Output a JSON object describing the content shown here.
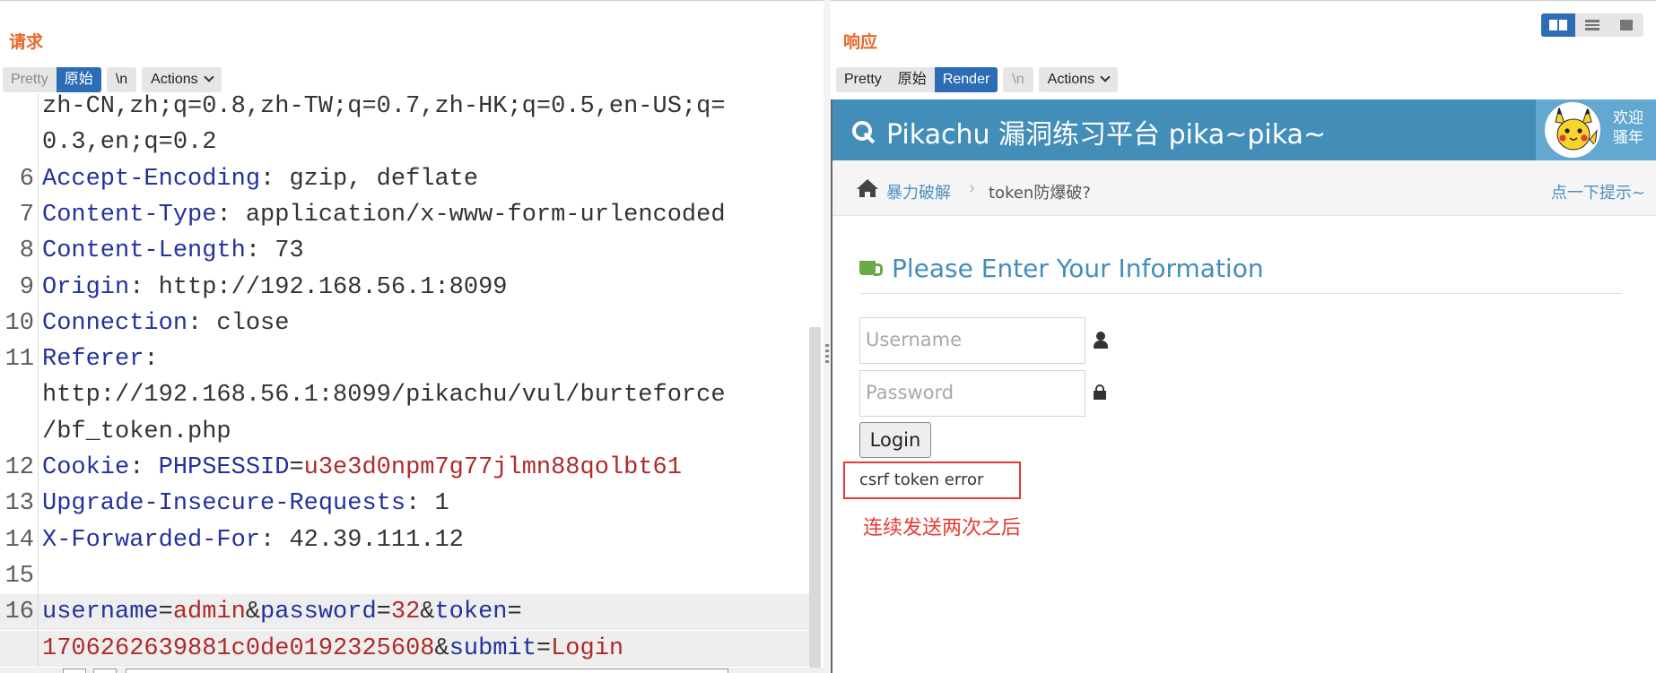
{
  "request": {
    "title": "请求",
    "tabs": {
      "pretty": "Pretty",
      "raw": "原始",
      "newline": "\\n",
      "actions": "Actions"
    },
    "lines": [
      {
        "n": "",
        "segments": [
          {
            "t": "zh-CN,zh;q=0.8,zh-TW;q=0.7,zh-HK;q=0.5,en-US;q=",
            "c": "v"
          }
        ]
      },
      {
        "n": "",
        "segments": [
          {
            "t": "0.3,en;q=0.2",
            "c": "v"
          }
        ]
      },
      {
        "n": "6",
        "segments": [
          {
            "t": "Accept-Encoding",
            "c": "k"
          },
          {
            "t": ": gzip, deflate",
            "c": "v"
          }
        ]
      },
      {
        "n": "7",
        "segments": [
          {
            "t": "Content-Type",
            "c": "k"
          },
          {
            "t": ": application/x-www-form-urlencoded",
            "c": "v"
          }
        ]
      },
      {
        "n": "8",
        "segments": [
          {
            "t": "Content-Length",
            "c": "k"
          },
          {
            "t": ": 73",
            "c": "v"
          }
        ]
      },
      {
        "n": "9",
        "segments": [
          {
            "t": "Origin",
            "c": "k"
          },
          {
            "t": ": http://192.168.56.1:8099",
            "c": "v"
          }
        ]
      },
      {
        "n": "10",
        "segments": [
          {
            "t": "Connection",
            "c": "k"
          },
          {
            "t": ": close",
            "c": "v"
          }
        ]
      },
      {
        "n": "11",
        "segments": [
          {
            "t": "Referer",
            "c": "k"
          },
          {
            "t": ":",
            "c": "v"
          }
        ]
      },
      {
        "n": "",
        "segments": [
          {
            "t": "http://192.168.56.1:8099/pikachu/vul/burteforce",
            "c": "v"
          }
        ]
      },
      {
        "n": "",
        "segments": [
          {
            "t": "/bf_token.php",
            "c": "v"
          }
        ]
      },
      {
        "n": "12",
        "segments": [
          {
            "t": "Cookie",
            "c": "k"
          },
          {
            "t": ": ",
            "c": "v"
          },
          {
            "t": "PHPSESSID",
            "c": "k"
          },
          {
            "t": "=",
            "c": "v"
          },
          {
            "t": "u3e3d0npm7g77jlmn88qolbt61",
            "c": "r"
          }
        ]
      },
      {
        "n": "13",
        "segments": [
          {
            "t": "Upgrade-Insecure-Requests",
            "c": "k"
          },
          {
            "t": ": 1",
            "c": "v"
          }
        ]
      },
      {
        "n": "14",
        "segments": [
          {
            "t": "X-Forwarded-For",
            "c": "k"
          },
          {
            "t": ": 42.39.111.12",
            "c": "v"
          }
        ]
      },
      {
        "n": "15",
        "segments": []
      },
      {
        "n": "16",
        "hl": true,
        "segments": [
          {
            "t": "username",
            "c": "k"
          },
          {
            "t": "=",
            "c": "v"
          },
          {
            "t": "admin",
            "c": "r"
          },
          {
            "t": "&",
            "c": "v"
          },
          {
            "t": "password",
            "c": "k"
          },
          {
            "t": "=",
            "c": "v"
          },
          {
            "t": "32",
            "c": "r"
          },
          {
            "t": "&",
            "c": "v"
          },
          {
            "t": "token",
            "c": "k"
          },
          {
            "t": "=",
            "c": "v"
          }
        ]
      },
      {
        "n": "",
        "hl": true,
        "segments": [
          {
            "t": "1706262639881c0de0192325608",
            "c": "r"
          },
          {
            "t": "&",
            "c": "v"
          },
          {
            "t": "submit",
            "c": "k"
          },
          {
            "t": "=",
            "c": "v"
          },
          {
            "t": "Login",
            "c": "r"
          }
        ]
      }
    ]
  },
  "response": {
    "title": "响应",
    "tabs": {
      "pretty": "Pretty",
      "raw": "原始",
      "render": "Render",
      "newline": "\\n",
      "actions": "Actions"
    },
    "render": {
      "site_title": "Pikachu 漏洞练习平台 pika~pika~",
      "welcome_line1": "欢迎",
      "welcome_line2": "骚年",
      "breadcrumb_1": "暴力破解",
      "breadcrumb_sep": "›",
      "breadcrumb_2": "token防爆破?",
      "hint_link": "点一下提示~",
      "section_title": "Please Enter Your Information",
      "username_placeholder": "Username",
      "password_placeholder": "Password",
      "login_label": "Login",
      "error_message": "csrf token error"
    }
  },
  "annotation": "连续发送两次之后",
  "colors": {
    "accent_orange": "#e8682a",
    "tab_active": "#2d6db5",
    "header_key": "#23329c",
    "value_red": "#b02a2a",
    "pikachu_blue": "#438eb9",
    "error_red": "#e53935"
  },
  "icons": [
    "key-icon",
    "home-icon",
    "cup-icon",
    "user-icon",
    "lock-icon",
    "chevron-down-icon",
    "split-view-icon",
    "rows-view-icon",
    "full-view-icon"
  ]
}
